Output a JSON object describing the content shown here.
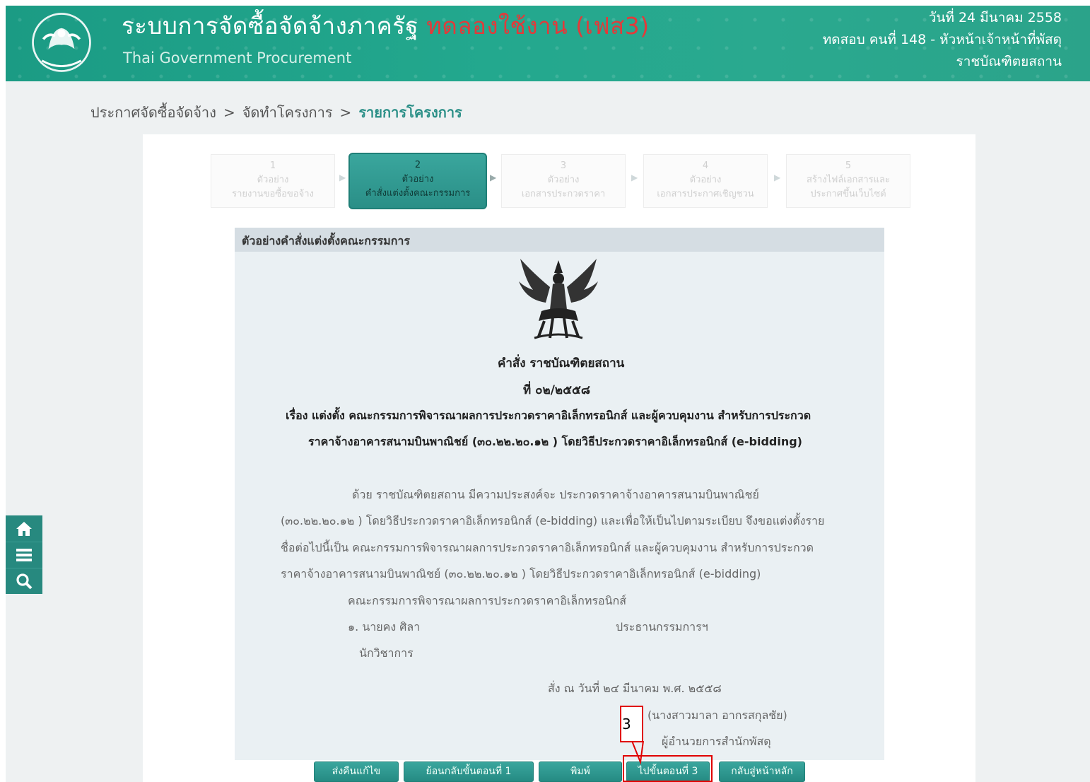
{
  "header": {
    "system_title": "ระบบการจัดซื้อจัดจ้างภาครัฐ",
    "test_label": "ทดลองใช้งาน (เฟส3)",
    "subtitle": "Thai Government Procurement",
    "date": "วันที่ 24 มีนาคม 2558",
    "user": "ทดสอบ คนที่ 148 - หัวหน้าเจ้าหน้าที่พัสดุ",
    "agency": "ราชบัณฑิตยสถาน"
  },
  "breadcrumb": {
    "items": [
      "ประกาศจัดซื้อจัดจ้าง",
      "จัดทำโครงการ",
      "รายการโครงการ"
    ],
    "separator": ">"
  },
  "stepper": [
    {
      "num": "1",
      "line1": "ตัวอย่าง",
      "line2": "รายงานขอซื้อขอจ้าง"
    },
    {
      "num": "2",
      "line1": "ตัวอย่าง",
      "line2": "คำสั่งแต่งตั้งคณะกรรมการ"
    },
    {
      "num": "3",
      "line1": "ตัวอย่าง",
      "line2": "เอกสารประกวดราคา"
    },
    {
      "num": "4",
      "line1": "ตัวอย่าง",
      "line2": "เอกสารประกาศเชิญชวน"
    },
    {
      "num": "5",
      "line1": "สร้างไฟล์เอกสารและ",
      "line2": "ประกาศขึ้นเว็บไซต์"
    }
  ],
  "document": {
    "panel_title": "ตัวอย่างคำสั่งแต่งตั้งคณะกรรมการ",
    "order_header": "คำสั่ง ราชบัณฑิตยสถาน",
    "order_no": "ที่ ๐๒/๒๕๕๘",
    "subject_1": "เรื่อง แต่งตั้ง คณะกรรมการพิจารณาผลการประกวดราคาอิเล็กทรอนิกส์ และผู้ควบคุมงาน สำหรับการประกวด",
    "subject_2": "ราคาจ้างอาคารสนามบินพาณิชย์ (๓๐.๒๒.๒๐.๑๒ ) โดยวิธีประกวดราคาอิเล็กทรอนิกส์ (e-bidding)",
    "body_1": "ด้วย ราชบัณฑิตยสถาน มีความประสงค์จะ ประกวดราคาจ้างอาคารสนามบินพาณิชย์",
    "body_2": "(๓๐.๒๒.๒๐.๑๒ ) โดยวิธีประกวดราคาอิเล็กทรอนิกส์ (e-bidding)  และเพื่อให้เป็นไปตามระเบียบ จึงขอแต่งตั้งราย",
    "body_3": "ชื่อต่อไปนี้เป็น คณะกรรมการพิจารณาผลการประกวดราคาอิเล็กทรอนิกส์ และผู้ควบคุมงาน สำหรับการประกวด",
    "body_4": "ราคาจ้างอาคารสนามบินพาณิชย์ (๓๐.๒๒.๒๐.๑๒ ) โดยวิธีประกวดราคาอิเล็กทรอนิกส์ (e-bidding)",
    "committee_title": "คณะกรรมการพิจารณาผลการประกวดราคาอิเล็กทรอนิกส์",
    "member_name": "๑. นายคง ศิลา",
    "member_role": "ประธานกรรมการฯ",
    "member_position": "นักวิชาการ",
    "ordered_date": "สั่ง ณ วันที่  ๒๔ มีนาคม พ.ศ. ๒๕๕๘",
    "signer_name": "(นางสาวมาลา อากรสกุลชัย)",
    "signer_position": "ผู้อำนวยการสำนักพัสดุ"
  },
  "buttons": {
    "return_edit": "ส่งคืนแก้ไข",
    "back_step1": "ย้อนกลับขั้นตอนที่ 1",
    "print": "พิมพ์",
    "next_step3": "ไปขั้นตอนที่ 3",
    "back_home": "กลับสู่หน้าหลัก"
  },
  "side_tools": [
    "home-icon",
    "menu-icon",
    "search-icon"
  ],
  "annotation": {
    "label": "3"
  },
  "colors": {
    "header": "#1f9e86",
    "accent": "#2a8f87",
    "marker": "#e00000"
  }
}
